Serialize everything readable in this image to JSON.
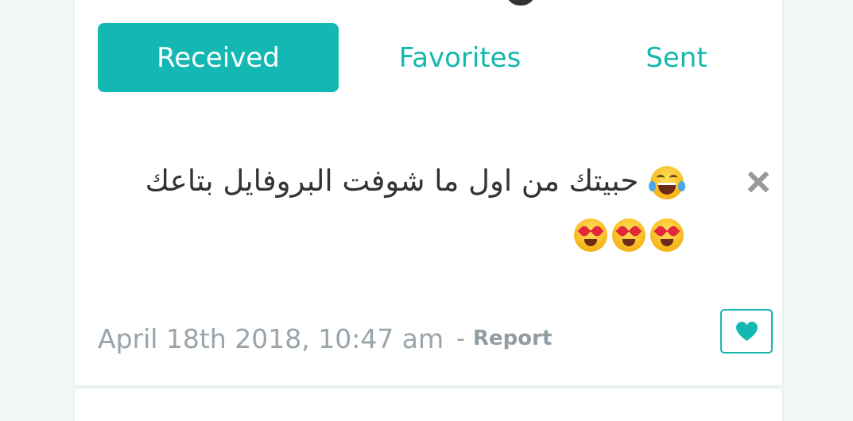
{
  "tabs": {
    "received_label": "Received",
    "favorites_label": "Favorites",
    "sent_label": "Sent",
    "active": "Received"
  },
  "message": {
    "text": "حبيتك من اول ما شوفت البروفايل بتاعك",
    "emojis": [
      "face-with-tears-of-joy",
      "smiling-face-with-heart-eyes",
      "smiling-face-with-heart-eyes",
      "smiling-face-with-heart-eyes"
    ],
    "timestamp": "April 18th 2018, 10:47 am",
    "separator": "-",
    "report_label": "Report"
  },
  "icons": {
    "close": "close-icon",
    "favorite": "heart-icon"
  },
  "colors": {
    "accent": "#12b8b1",
    "text": "#333333",
    "muted": "#9aa4ab",
    "close_icon": "#999999"
  }
}
